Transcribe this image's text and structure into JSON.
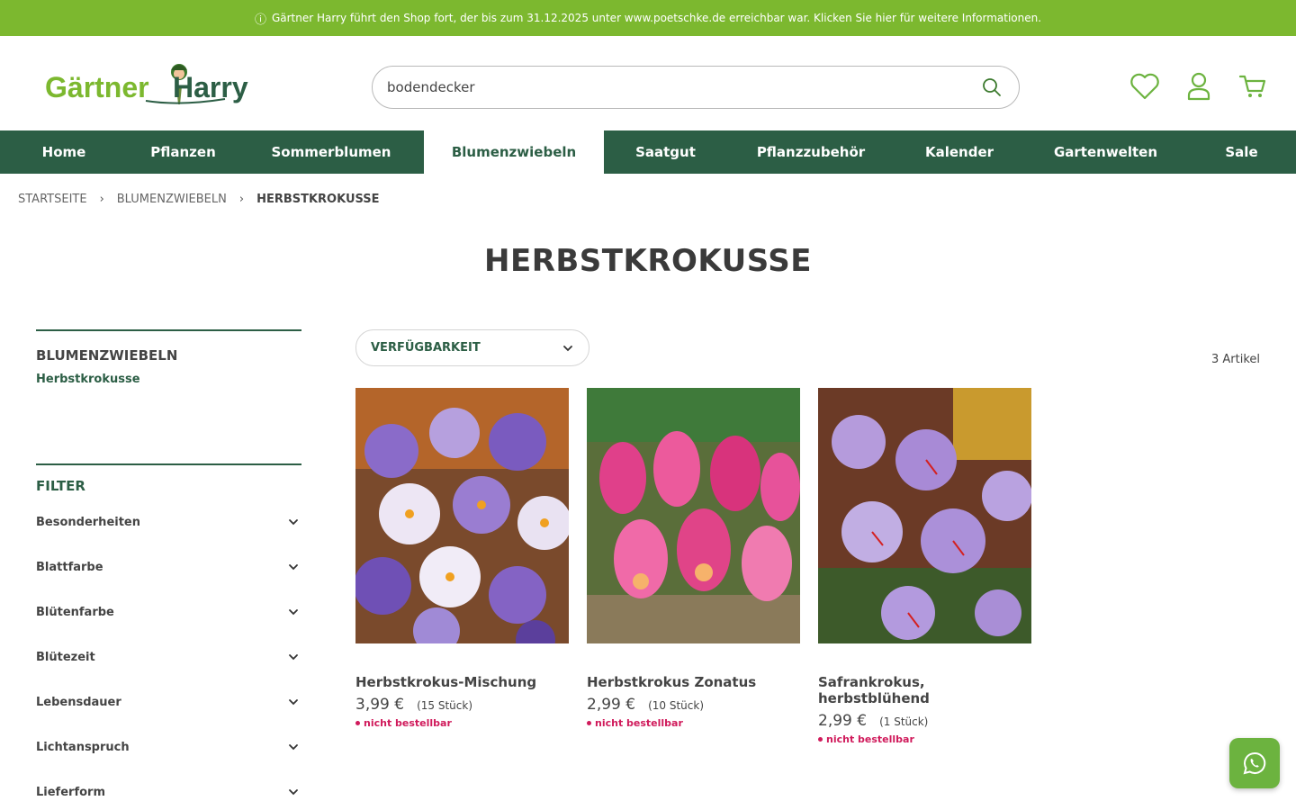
{
  "topbar": {
    "icon": "info-icon",
    "text": "Gärtner Harry führt den Shop fort, der bis zum 31.12.2025 unter www.poetschke.de erreichbar war. Klicken Sie hier für weitere Informationen."
  },
  "header": {
    "logo_text": "Gärtner Harry",
    "search": {
      "value": "bodendecker",
      "icon": "search-icon"
    },
    "icons": [
      "heart-icon",
      "user-icon",
      "cart-icon"
    ]
  },
  "nav": {
    "active": "Blumenzwiebeln",
    "items": [
      "Home",
      "Pflanzen",
      "Sommerblumen",
      "Blumenzwiebeln",
      "Saatgut",
      "Pflanzzubehör",
      "Kalender",
      "Gartenwelten",
      "Sale"
    ]
  },
  "breadcrumb": [
    "Startseite",
    "Blumenzwiebeln",
    "Herbstkrokusse"
  ],
  "page_title": "HERBSTKROKUSSE",
  "sidebar": {
    "category_heading": "BLUMENZWIEBELN",
    "category_link": "Herbstkrokusse",
    "filter_heading": "FILTER",
    "filters": [
      "Besonderheiten",
      "Blattfarbe",
      "Blütenfarbe",
      "Blütezeit",
      "Lebensdauer",
      "Lichtanspruch",
      "Lieferform"
    ]
  },
  "toolbar": {
    "availability_label": "VERFÜGBARKEIT",
    "count_label": "3 Artikel"
  },
  "products": [
    {
      "name": "Herbstkrokus-Mischung",
      "price": "3,99 €",
      "qty": "(15 Stück)",
      "status": "nicht bestellbar",
      "image": "purple-white-crocus-mix"
    },
    {
      "name": "Herbstkrokus Zonatus",
      "price": "2,99 €",
      "qty": "(10 Stück)",
      "status": "nicht bestellbar",
      "image": "pink-crocus"
    },
    {
      "name": "Safrankrokus, herbstblühend",
      "price": "2,99 €",
      "qty": "(1 Stück)",
      "status": "nicht bestellbar",
      "image": "lilac-saffron-crocus"
    }
  ],
  "colors": {
    "topbar_green": "#7cb82f",
    "nav_green": "#2c5e45",
    "status_red": "#d01a5b",
    "whatsapp_green": "#6cb33f"
  },
  "whatsapp": {
    "icon": "whatsapp-icon"
  }
}
